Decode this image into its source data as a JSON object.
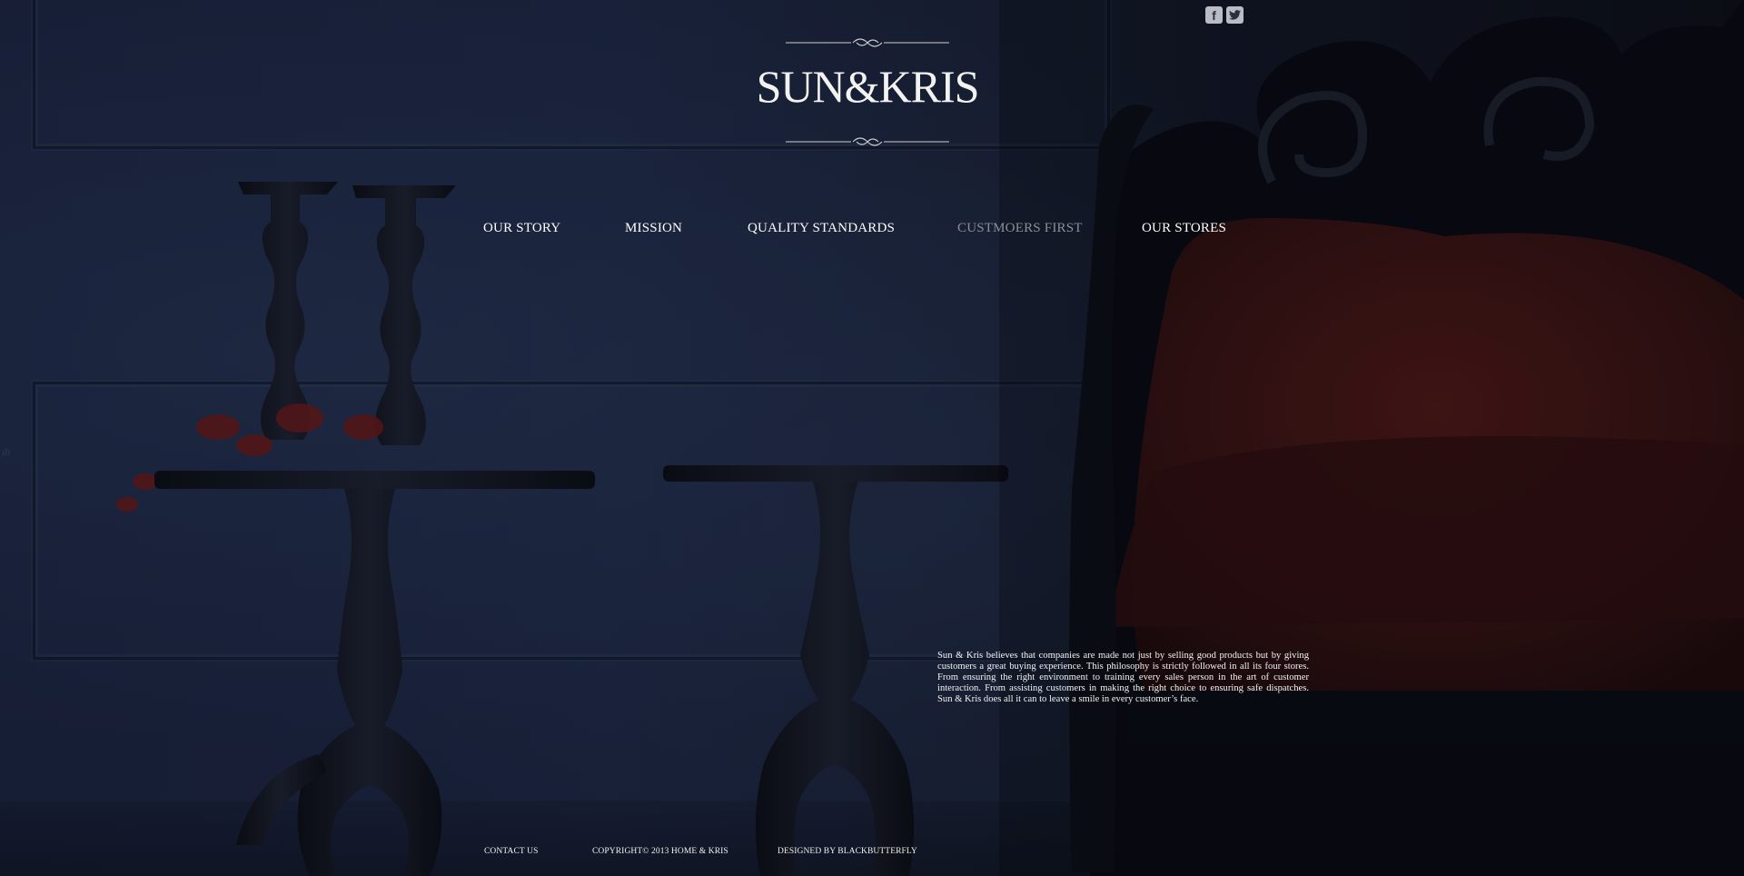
{
  "header": {
    "logo_text": "SUN&KRIS",
    "social": [
      {
        "name": "facebook",
        "glyph": "f"
      },
      {
        "name": "twitter",
        "glyph": "t"
      }
    ]
  },
  "nav": {
    "items": [
      {
        "label": "OUR STORY"
      },
      {
        "label": "MISSION"
      },
      {
        "label": "QUALITY STANDARDS"
      },
      {
        "label": "CUSTMOERS FIRST",
        "active": true
      },
      {
        "label": "OUR STORES"
      }
    ]
  },
  "main": {
    "intro_text": "Sun & Kris believes that companies are made not just by selling good products but by giving customers a great buying experience. This philosophy is strictly followed in all its four stores. From ensuring the right environment to training every sales person in the art of customer interaction. From assisting customers in making the right choice to ensuring safe dispatches. Sun & Kris does all it can to leave a smile in every customer’s face."
  },
  "footer": {
    "contact": "CONTACT US",
    "copyright": "COPYRIGHT© 2013 HOME & KRIS",
    "designed_by": "DESIGNED BY BLACKBUTTERFLY"
  },
  "colors": {
    "background": "#15192a",
    "text": "#f1f1f1",
    "nav_active": "#8c8f99",
    "upholstery": "#5a1a18"
  }
}
